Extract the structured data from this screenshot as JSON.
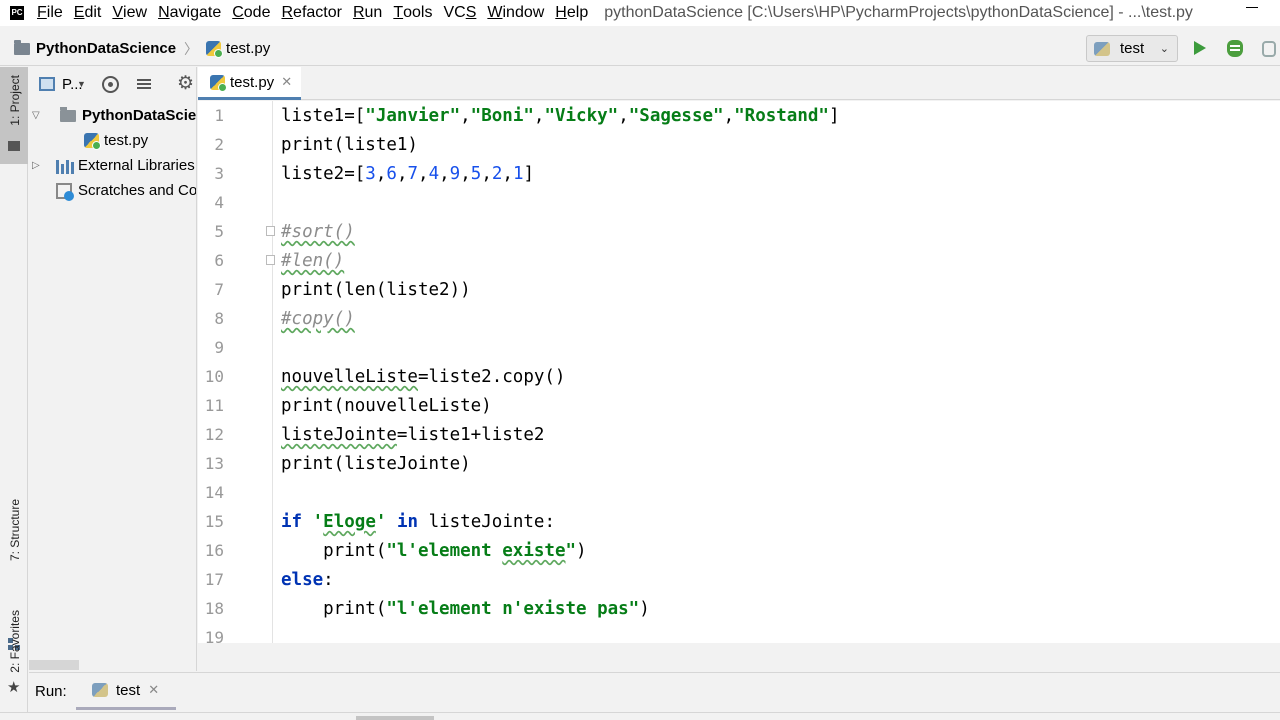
{
  "menubar": {
    "items": [
      {
        "label": "File",
        "mnemonic": "F",
        "rest": "ile"
      },
      {
        "label": "Edit",
        "mnemonic": "E",
        "rest": "dit"
      },
      {
        "label": "View",
        "mnemonic": "V",
        "rest": "iew"
      },
      {
        "label": "Navigate",
        "mnemonic": "N",
        "rest": "avigate"
      },
      {
        "label": "Code",
        "mnemonic": "C",
        "rest": "ode"
      },
      {
        "label": "Refactor",
        "mnemonic": "R",
        "rest": "efactor"
      },
      {
        "label": "Run",
        "mnemonic": "R",
        "rest": "un"
      },
      {
        "label": "Tools",
        "mnemonic": "T",
        "rest": "ools"
      },
      {
        "label": "VCS",
        "mnemonic": "S",
        "rest": "VC"
      },
      {
        "label": "Window",
        "mnemonic": "W",
        "rest": "indow"
      },
      {
        "label": "Help",
        "mnemonic": "H",
        "rest": "elp"
      }
    ],
    "window_title": "pythonDataScience [C:\\Users\\HP\\PycharmProjects\\pythonDataScience] - ...\\test.py"
  },
  "navbar": {
    "project": "PythonDataScience",
    "file": "test.py",
    "run_config": "test"
  },
  "left_strip": {
    "project_label": "1: Project",
    "structure_label": "7: Structure",
    "favorites_label": "2: Favorites"
  },
  "project_panel": {
    "view_label": "P...",
    "tree": [
      {
        "label": "PythonDataScie",
        "bold": true
      },
      {
        "label": "test.py"
      },
      {
        "label": "External Libraries"
      },
      {
        "label": "Scratches and Co"
      }
    ]
  },
  "editor": {
    "tab": "test.py",
    "line_numbers": [
      "1",
      "2",
      "3",
      "4",
      "5",
      "6",
      "7",
      "8",
      "9",
      "10",
      "11",
      "12",
      "13",
      "14",
      "15",
      "16",
      "17",
      "18",
      "19"
    ]
  },
  "runbar": {
    "label": "Run:",
    "tab": "test"
  },
  "colors": {
    "string": "#067d17",
    "number": "#1750eb",
    "comment": "#8c8c8c",
    "keyword": "#0033b3",
    "run_green": "#3c9b3c"
  }
}
